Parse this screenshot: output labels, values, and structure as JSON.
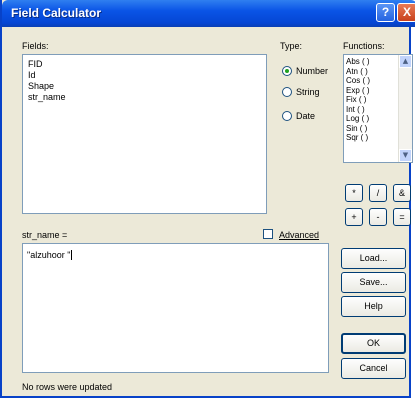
{
  "window": {
    "title": "Field Calculator",
    "help_glyph": "?",
    "close_glyph": "X"
  },
  "fields": {
    "label": "Fields:",
    "items": [
      "FID",
      "Id",
      "Shape",
      "str_name"
    ]
  },
  "type": {
    "label": "Type:",
    "options": [
      {
        "label": "Number",
        "selected": true
      },
      {
        "label": "String",
        "selected": false
      },
      {
        "label": "Date",
        "selected": false
      }
    ]
  },
  "functions": {
    "label": "Functions:",
    "items": [
      "Abs ( )",
      "Atn ( )",
      "Cos ( )",
      "Exp ( )",
      "Fix ( )",
      "Int ( )",
      "Log ( )",
      "Sin ( )",
      "Sqr ( )"
    ]
  },
  "operators": [
    "*",
    "/",
    "&",
    "+",
    "-",
    "="
  ],
  "expression": {
    "label": "str_name =",
    "value": "\"alzuhoor \""
  },
  "advanced": {
    "label": "Advanced",
    "checked": false
  },
  "buttons": {
    "load": "Load...",
    "save": "Save...",
    "help": "Help",
    "ok": "OK",
    "cancel": "Cancel"
  },
  "status": "No rows were updated"
}
